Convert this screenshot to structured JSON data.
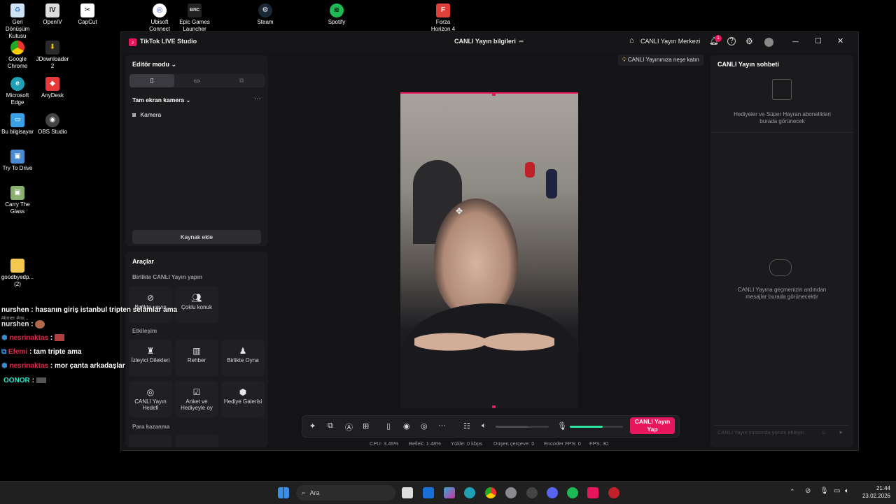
{
  "desktop": {
    "icons": [
      {
        "label": "Geri Dönüşüm Kutusu",
        "icon": "recycle-bin-icon",
        "color": "#3a7bd5"
      },
      {
        "label": "OpenIV",
        "icon": "openiv-icon",
        "color": "#666666"
      },
      {
        "label": "CapCut",
        "icon": "capcut-icon",
        "color": "#ffffff"
      },
      {
        "label": "Ubisoft Connect",
        "icon": "ubisoft-icon",
        "color": "#3f5bd6"
      },
      {
        "label": "Epic Games Launcher",
        "icon": "epic-icon",
        "color": "#222222"
      },
      {
        "label": "Steam",
        "icon": "steam-icon",
        "color": "#1b2838"
      },
      {
        "label": "Spotify",
        "icon": "spotify-icon",
        "color": "#1db954"
      },
      {
        "label": "Forza Horizon 4",
        "icon": "forza-icon",
        "color": "#e0403a"
      },
      {
        "label": "Google Chrome",
        "icon": "chrome-icon",
        "color": "#e8b300"
      },
      {
        "label": "JDownloader 2",
        "icon": "jdownloader-icon",
        "color": "#f2c300"
      },
      {
        "label": "Microsoft Edge",
        "icon": "edge-icon",
        "color": "#1fa0b5"
      },
      {
        "label": "AnyDesk",
        "icon": "anydesk-icon",
        "color": "#e63a3a"
      },
      {
        "label": "Bu bilgisayar",
        "icon": "this-pc-icon",
        "color": "#3aa0e6"
      },
      {
        "label": "OBS Studio",
        "icon": "obs-icon",
        "color": "#2b2b2b"
      },
      {
        "label": "Try To Drive",
        "icon": "game-icon",
        "color": "#4a8ad0"
      },
      {
        "label": "Carry The Glass",
        "icon": "game-icon",
        "color": "#8ab070"
      },
      {
        "label": "goodbyedp... (2)",
        "icon": "folder-icon",
        "color": "#f2c94c"
      }
    ]
  },
  "overlay_chat": [
    {
      "user": "nurshen",
      "text": ": hasanın giriş istanbul tripten selamlar ama",
      "color": "#ffffff"
    },
    {
      "user": "nurshen",
      "text": ":",
      "color": "#ffffff"
    },
    {
      "user": "nesrinaktas",
      "text": ":",
      "color": "#e0284a"
    },
    {
      "user": "Efemi",
      "text": ": tam tripte ama",
      "color": "#e0284a"
    },
    {
      "user": "nesrinaktas",
      "text": ": mor çanta arkadaşlar",
      "color": "#e0284a"
    },
    {
      "user": "OONOR",
      "text": ":",
      "color": "#2ee6c8"
    }
  ],
  "overlay_timer": "#timer #mi...",
  "window": {
    "app_title": "TikTok LIVE Studio",
    "center_title": "CANLI Yayın bilgileri",
    "live_center": "CANLI Yayın Merkezi",
    "notif_count": "1"
  },
  "editor": {
    "mode_label": "Editör modu",
    "scene_label": "Tam ekran kamera",
    "sources": [
      "Kamera"
    ],
    "add_source": "Kaynak ekle"
  },
  "tools": {
    "title": "Araçlar",
    "collab_title": "Birlikte CANLI Yayın yapın",
    "collab": [
      "Birlikte yayın",
      "Çoklu konuk"
    ],
    "engagement_title": "Etkileşim",
    "engagement_row1": [
      "İzleyici Dilekleri",
      "Rehber",
      "Birlikte Oyna"
    ],
    "engagement_row2": [
      "CANLI Yayın Hedefi",
      "Anket ve Hediyeyle oy",
      "Hediye Galerisi"
    ],
    "earn_title": "Para kazanma"
  },
  "banner": "CANLI Yayınınıza neşe katın",
  "chat": {
    "title": "CANLI Yayın sohbeti",
    "gifts_text": "Hediyeler ve Süper Hayran abonelikleri burada görünecek",
    "empty_text": "CANLI Yayına geçmenizin ardından mesajlar burada görünecektir",
    "input_placeholder": "CANLI Yayın sırasında yorum ekleyin"
  },
  "bottom": {
    "go_live": "CANLI Yayın Yap",
    "volume_level": 0.6,
    "mic_level": 0.62
  },
  "stats": {
    "cpu": "CPU: 3.49%",
    "memory": "Bellek: 1.48%",
    "upload": "Yükle: 0 kbps",
    "dropped": "Düşen çerçeve: 0",
    "encoder": "Encoder FPS: 0",
    "fps": "FPS: 30"
  },
  "taskbar": {
    "search": "Ara",
    "time": "21:44",
    "date": "23.02.2026"
  },
  "colors": {
    "accent": "#e8175d",
    "bg": "#141416",
    "panel": "#1b1b1e",
    "mic": "#2ee6a0"
  }
}
